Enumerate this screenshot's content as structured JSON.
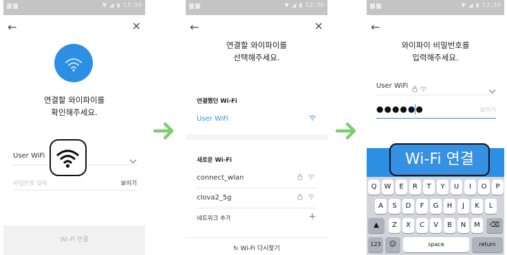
{
  "status_bar": {
    "time": "12:30"
  },
  "colors": {
    "accent": "#2c8fe3",
    "arrow": "#7ccd6f",
    "link": "#3e8fe4"
  },
  "screen1": {
    "back_icon": "←",
    "close_icon": "×",
    "title_line1": "연결할 와이파이를",
    "title_line2": "확인해주세요.",
    "network_value": "User WiFi",
    "password_placeholder": "비밀번호 입력",
    "show_label": "보이기",
    "footer_button": "Wi-Fi 연결"
  },
  "screen2": {
    "back_icon": "←",
    "close_icon": "×",
    "title_line1": "연결할 와이파이를",
    "title_line2": "선택해주세요.",
    "section_connected": "연결했던 Wi-Fi",
    "connected_network": "User WiFi",
    "section_new": "새로운 Wi-Fi",
    "networks": [
      "connect_wlan",
      "clova2_5g"
    ],
    "add_network": "네트워크 추가",
    "rescan": "Wi-Fi 다시찾기"
  },
  "screen3": {
    "back_icon": "←",
    "title_line1": "와이파이 비밀번호를",
    "title_line2": "입력해주세요.",
    "network_value": "User WiFi",
    "password_value": "●●●●●●",
    "show_label": "보이기",
    "connect_button": "Wi-Fi 연결",
    "keyboard": {
      "row1": [
        "Q",
        "W",
        "E",
        "R",
        "T",
        "Y",
        "U",
        "I",
        "O",
        "P"
      ],
      "row2": [
        "A",
        "S",
        "D",
        "F",
        "G",
        "H",
        "J",
        "K",
        "L"
      ],
      "row3": [
        "Z",
        "X",
        "C",
        "V",
        "B",
        "N",
        "M"
      ],
      "key_123": "123",
      "key_space": "space",
      "key_return": "return"
    }
  }
}
